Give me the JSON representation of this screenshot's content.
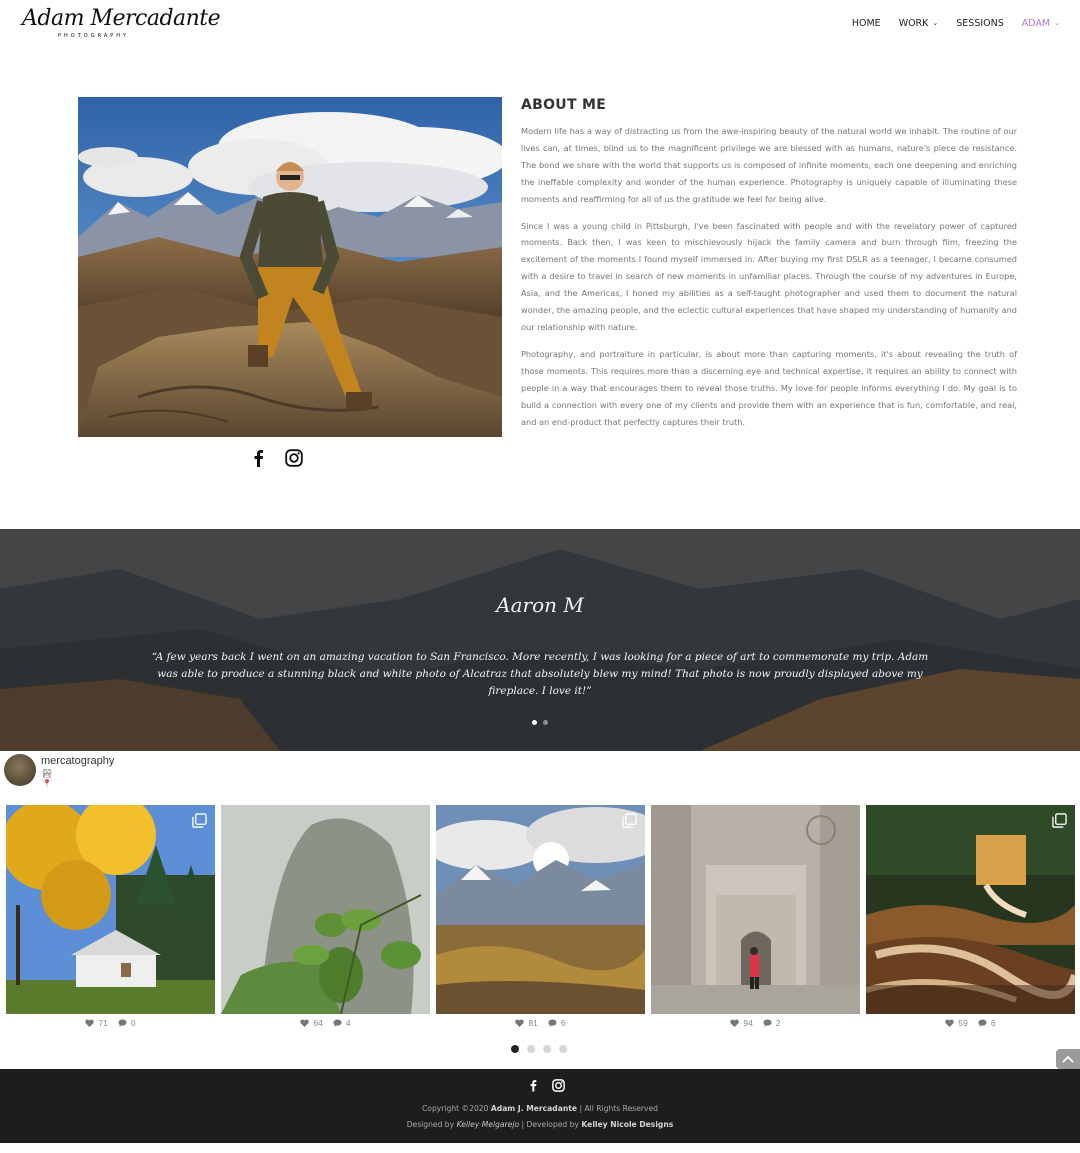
{
  "header": {
    "logo_script": "Adam Mercadante",
    "logo_sub": "PHOTOGRAPHY",
    "nav": [
      {
        "label": "HOME"
      },
      {
        "label": "WORK"
      },
      {
        "label": "SESSIONS"
      },
      {
        "label": "ADAM"
      }
    ]
  },
  "about": {
    "title": "ABOUT ME",
    "paragraphs": [
      "Modern life has a way of distracting us from the awe-inspiring beauty of the natural world we inhabit. The routine of our lives can, at times, blind us to the magnificent privilege we are blessed with as humans, nature's piece de resistance. The bond we share with the world that supports us is composed of infinite moments, each one deepening and enriching the ineffable complexity and wonder of the human experience. Photography is uniquely capable of illuminating these moments and reaffirming for all of us the gratitude we feel for being alive.",
      "Since I was a young child in Pittsburgh, I've been fascinated with people and with the revelatory power of captured moments. Back then, I was keen to mischievously hijack the family camera and burn through film, freezing the excitement of the moments I found myself immersed in. After buying my first DSLR as a teenager, I became consumed with a desire to travel in search of new moments in unfamiliar places. Through the course of my adventures in Europe, Asia, and the Americas, I honed my abilities as a self-taught photographer and used them to document the natural wonder, the amazing people, and the eclectic cultural experiences that have shaped my understanding of humanity and our relationship with nature.",
      "Photography, and portraiture in particular, is about more than capturing moments, it's about revealing the truth of those moments. This requires more than a discerning eye and technical expertise, it requires an ability to connect with people in a way that encourages them to reveal those truths. My love for people informs everything I do. My goal is to build a connection with every one of my clients and provide them with an experience that is fun, comfortable, and real, and an end-product that perfectly captures their truth."
    ]
  },
  "testimonial": {
    "name": "Aaron M",
    "quote": "“A few years back I went on an amazing vacation to San Francisco. More recently, I was looking for a piece of art to commemorate my trip. Adam was able to produce a stunning  black and white photo of Alcatraz that absolutely blew my mind! That photo is now proudly displayed above my fireplace. I love it!”",
    "active_slide": 1,
    "slide_count": 2
  },
  "instagram": {
    "username": "mercatography",
    "emoji": [
      "🏞",
      "📍"
    ],
    "posts": [
      {
        "likes": "71",
        "comments": "0",
        "multi": true
      },
      {
        "likes": "64",
        "comments": "4",
        "multi": false
      },
      {
        "likes": "81",
        "comments": "6",
        "multi": true
      },
      {
        "likes": "94",
        "comments": "2",
        "multi": false
      },
      {
        "likes": "59",
        "comments": "6",
        "multi": true
      }
    ],
    "active_page": 1,
    "page_count": 4
  },
  "footer": {
    "copyright_prefix": "Copyright ©2020",
    "copyright_name": "Adam J. Mercadante",
    "copyright_suffix": "| All Rights Reserved",
    "designed_prefix": "Designed by",
    "designer": "Kelley Melgarejo",
    "developed_prefix": "| Developed by",
    "developer": "Kelley Nicole Designs"
  },
  "colors": {
    "accent": "#b374d2",
    "footer_bg": "#1d1d1d"
  },
  "icons": [
    "facebook-icon",
    "instagram-icon",
    "heart-icon",
    "comment-icon",
    "multi-image-icon",
    "chevron-down-icon",
    "chevron-up-icon"
  ]
}
